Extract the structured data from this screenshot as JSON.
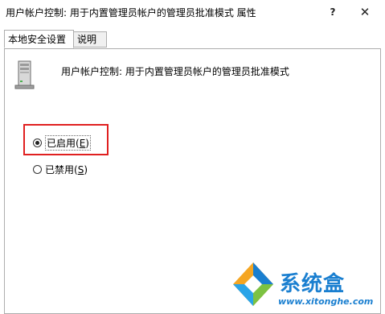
{
  "window": {
    "title": "用户帐户控制: 用于内置管理员帐户的管理员批准模式 属性",
    "help_label": "?",
    "close_label": "✕"
  },
  "tabs": [
    {
      "label": "本地安全设置",
      "active": true
    },
    {
      "label": "说明",
      "active": false
    }
  ],
  "policy": {
    "name": "用户帐户控制: 用于内置管理员帐户的管理员批准模式",
    "icon": "server-policy-icon"
  },
  "options": [
    {
      "label": "已启用",
      "accel": "E",
      "checked": true
    },
    {
      "label": "已禁用",
      "accel": "S",
      "checked": false
    }
  ],
  "highlight_color": "#e02020",
  "watermark": {
    "brand": "系统盒",
    "url": "www.xitonghe.com",
    "color": "#1a7fd0"
  }
}
